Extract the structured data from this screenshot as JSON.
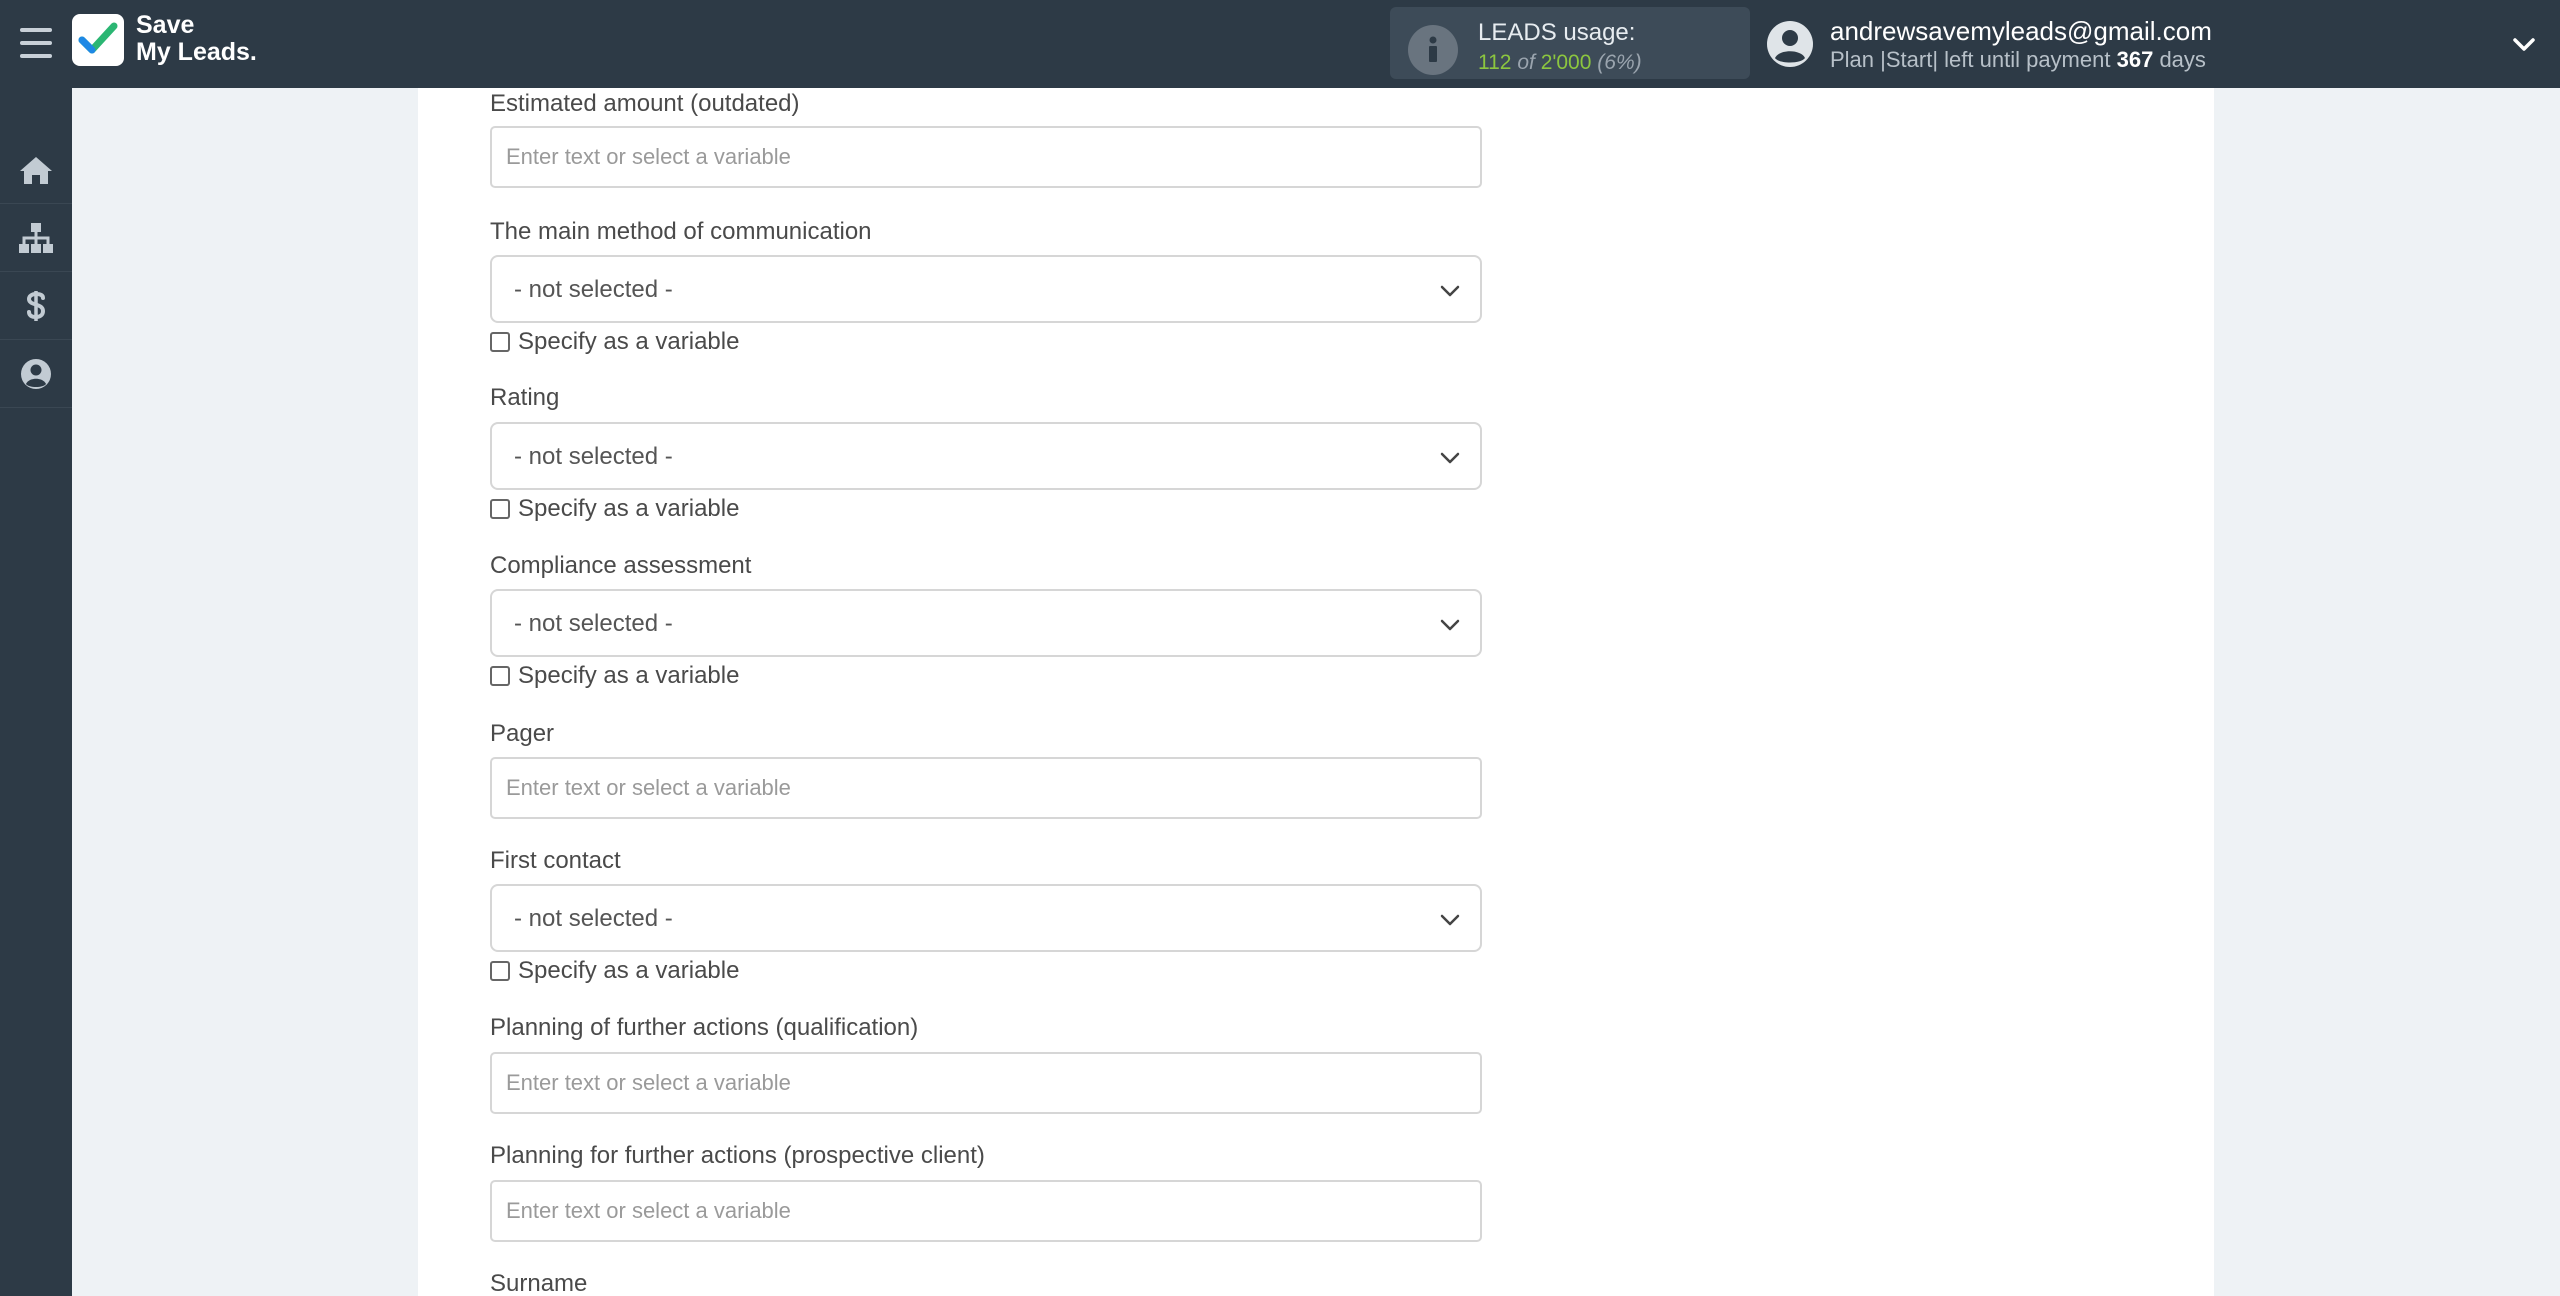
{
  "brand": {
    "line1": "Save",
    "line2": "My Leads."
  },
  "usage": {
    "title": "LEADS usage:",
    "used": "112",
    "of_word": "of",
    "limit": "2'000",
    "percent": "(6%)"
  },
  "user": {
    "email": "andrewsavemyleads@gmail.com",
    "plan_prefix": "Plan |Start| left until payment",
    "days": "367",
    "days_suffix": "days"
  },
  "sidebar": {
    "items": [
      {
        "icon": "home-icon"
      },
      {
        "icon": "sitemap-icon"
      },
      {
        "icon": "dollar-icon"
      },
      {
        "icon": "user-circle-icon"
      }
    ]
  },
  "form": {
    "placeholder": "Enter text or select a variable",
    "select_default": "- not selected -",
    "checkbox_label": "Specify as a variable",
    "fields": {
      "estimated_amount": "Estimated amount (outdated)",
      "communication_method": "The main method of communication",
      "rating": "Rating",
      "compliance": "Compliance assessment",
      "pager": "Pager",
      "first_contact": "First contact",
      "planning_qualification": "Planning of further actions (qualification)",
      "planning_prospective": "Planning for further actions (prospective client)",
      "surname": "Surname"
    }
  }
}
